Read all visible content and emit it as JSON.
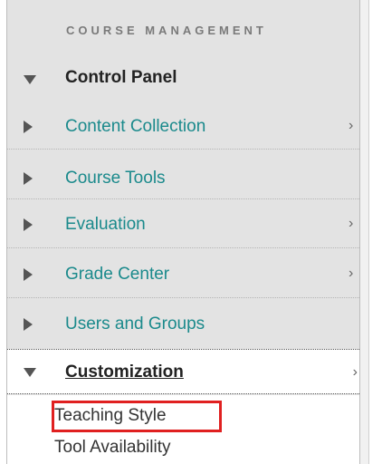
{
  "section_title": "COURSE MANAGEMENT",
  "control_panel": {
    "label": "Control Panel",
    "expanded": true
  },
  "menu_items": [
    {
      "label": "Content Collection",
      "has_submenu": true
    },
    {
      "label": "Course Tools",
      "has_submenu": false
    },
    {
      "label": "Evaluation",
      "has_submenu": true
    },
    {
      "label": "Grade Center",
      "has_submenu": true
    },
    {
      "label": "Users and Groups",
      "has_submenu": false
    }
  ],
  "customization": {
    "label": "Customization",
    "expanded": true,
    "has_submenu": true
  },
  "sub_items": [
    {
      "label": "Teaching Style",
      "highlighted": true
    },
    {
      "label": "Tool Availability",
      "highlighted": false
    }
  ],
  "chevron_glyph": "›",
  "colors": {
    "link": "#1b8a8c",
    "panel_bg": "#e3e3e3",
    "highlight": "#e02020"
  },
  "icons": {
    "collapsed": "triangle-right-icon",
    "expanded": "triangle-down-icon",
    "submenu": "chevron-right-icon"
  }
}
